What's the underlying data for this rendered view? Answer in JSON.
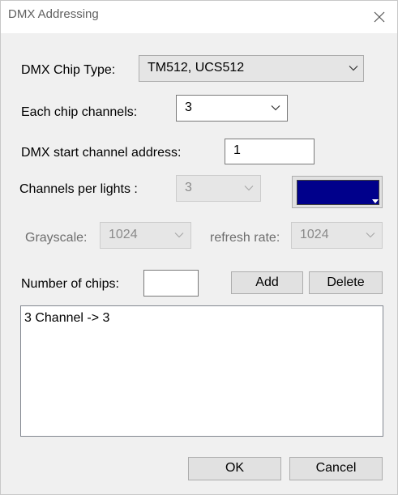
{
  "window": {
    "title": "DMX Addressing"
  },
  "chip_type": {
    "label": "DMX Chip Type:",
    "value": "TM512, UCS512"
  },
  "chip_channels": {
    "label": "Each chip channels:",
    "value": "3"
  },
  "start_address": {
    "label": "DMX start channel address:",
    "value": "1"
  },
  "channels_per_light": {
    "label": "Channels per lights :",
    "value": "3",
    "color": "#00008b"
  },
  "grayscale": {
    "label": "Grayscale:",
    "value": "1024"
  },
  "refresh_rate": {
    "label": "refresh rate:",
    "value": "1024"
  },
  "chips": {
    "label": "Number of chips:",
    "value": "",
    "add_label": "Add",
    "delete_label": "Delete"
  },
  "channel_list": {
    "items": [
      "3 Channel -> 3"
    ]
  },
  "footer": {
    "ok_label": "OK",
    "cancel_label": "Cancel"
  }
}
